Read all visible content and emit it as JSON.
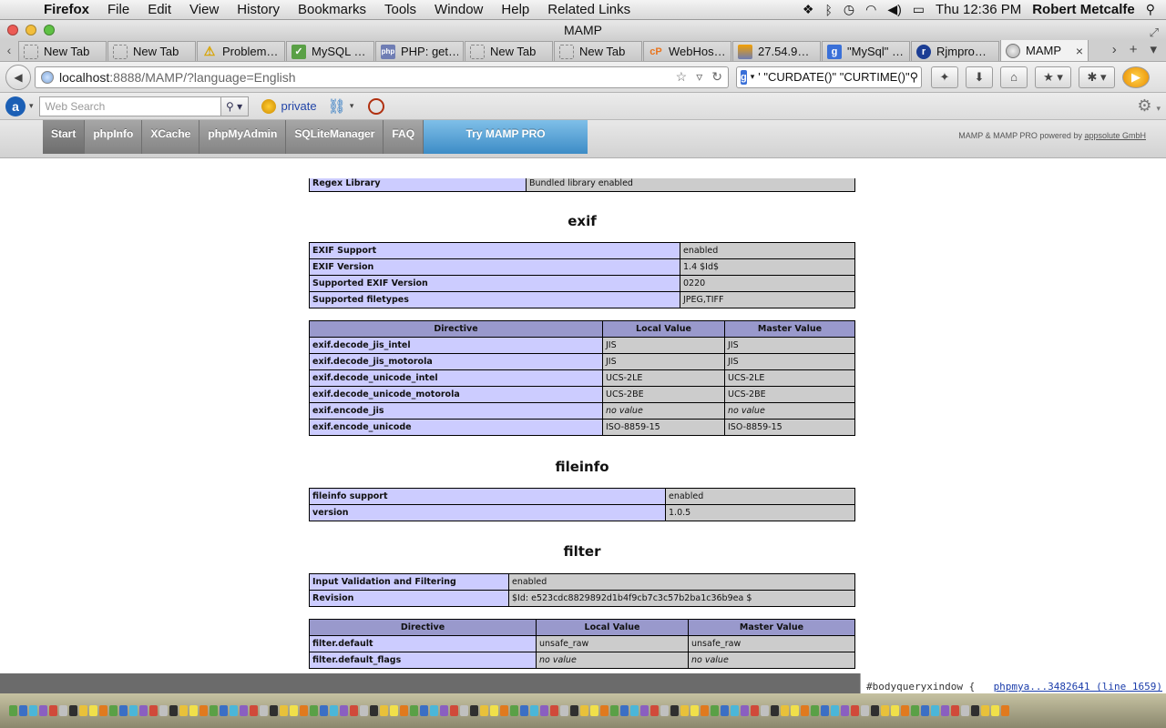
{
  "menubar": {
    "app": "Firefox",
    "items": [
      "File",
      "Edit",
      "View",
      "History",
      "Bookmarks",
      "Tools",
      "Window",
      "Help",
      "Related Links"
    ],
    "clock": "Thu 12:36 PM",
    "user": "Robert Metcalfe"
  },
  "window": {
    "title": "MAMP"
  },
  "tabs": [
    {
      "label": "New Tab",
      "icon": "blank-page-icon"
    },
    {
      "label": "New Tab",
      "icon": "blank-page-icon"
    },
    {
      "label": "Problem…",
      "icon": "warning-icon"
    },
    {
      "label": "MySQL …",
      "icon": "mysql-icon"
    },
    {
      "label": "PHP: get…",
      "icon": "php-icon"
    },
    {
      "label": "New Tab",
      "icon": "blank-page-icon"
    },
    {
      "label": "New Tab",
      "icon": "blank-page-icon"
    },
    {
      "label": "WebHos…",
      "icon": "cpanel-icon"
    },
    {
      "label": "27.54.9…",
      "icon": "phpmyadmin-icon"
    },
    {
      "label": "\"MySql\" …",
      "icon": "google-icon"
    },
    {
      "label": "Rjmpro…",
      "icon": "site-icon"
    },
    {
      "label": "MAMP",
      "icon": "globe-icon",
      "active": true
    }
  ],
  "navbar": {
    "url_host": "localhost",
    "url_rest": ":8888/MAMP/?language=English",
    "search_value": "' \"CURDATE()\" \"CURTIME()\""
  },
  "addonbar": {
    "websearch_placeholder": "Web Search",
    "private_label": "private"
  },
  "mamp": {
    "tabs": [
      "Start",
      "phpInfo",
      "XCache",
      "phpMyAdmin",
      "SQLiteManager",
      "FAQ",
      "Try MAMP PRO"
    ],
    "credit_prefix": "MAMP & MAMP PRO powered by ",
    "credit_link": "appsolute GmbH"
  },
  "phpinfo": {
    "top_partial": {
      "key": "Regex Library",
      "value": "Bundled library enabled"
    },
    "directive_headers": [
      "Directive",
      "Local Value",
      "Master Value"
    ],
    "sections": [
      {
        "title": "exif",
        "info": [
          [
            "EXIF Support",
            "enabled"
          ],
          [
            "EXIF Version",
            "1.4 $Id$"
          ],
          [
            "Supported EXIF Version",
            "0220"
          ],
          [
            "Supported filetypes",
            "JPEG,TIFF"
          ]
        ],
        "directives": [
          [
            "exif.decode_jis_intel",
            "JIS",
            "JIS"
          ],
          [
            "exif.decode_jis_motorola",
            "JIS",
            "JIS"
          ],
          [
            "exif.decode_unicode_intel",
            "UCS-2LE",
            "UCS-2LE"
          ],
          [
            "exif.decode_unicode_motorola",
            "UCS-2BE",
            "UCS-2BE"
          ],
          [
            "exif.encode_jis",
            "no value",
            "no value"
          ],
          [
            "exif.encode_unicode",
            "ISO-8859-15",
            "ISO-8859-15"
          ]
        ]
      },
      {
        "title": "fileinfo",
        "info": [
          [
            "fileinfo support",
            "enabled"
          ],
          [
            "version",
            "1.0.5"
          ]
        ]
      },
      {
        "title": "filter",
        "info": [
          [
            "Input Validation and Filtering",
            "enabled"
          ],
          [
            "Revision",
            "$Id: e523cdc8829892d1b4f9cb7c3c57b2ba1c36b9ea $"
          ]
        ],
        "directives": [
          [
            "filter.default",
            "unsafe_raw",
            "unsafe_raw"
          ],
          [
            "filter.default_flags",
            "no value",
            "no value"
          ]
        ]
      }
    ]
  },
  "console": {
    "selector": "#bodyqueryxindow {",
    "link": "phpmya...3482641 (line 1659)"
  }
}
